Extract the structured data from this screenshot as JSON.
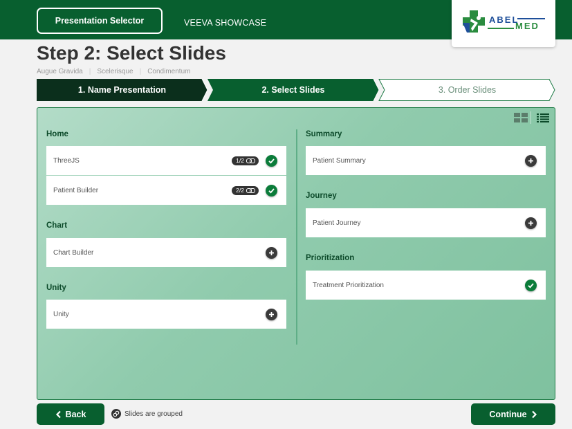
{
  "header": {
    "selector_label": "Presentation Selector",
    "showcase_label": "VEEVA SHOWCASE",
    "logo_top": "ABEL",
    "logo_bottom": "MED"
  },
  "page": {
    "title": "Step 2: Select Slides",
    "breadcrumb": [
      "Augue Gravida",
      "Scelerisque",
      "Condimentum"
    ]
  },
  "steps": [
    {
      "label": "1. Name Presentation",
      "state": "done"
    },
    {
      "label": "2. Select Slides",
      "state": "active"
    },
    {
      "label": "3. Order Slides",
      "state": "pending"
    }
  ],
  "columns": {
    "left": [
      {
        "title": "Home",
        "items": [
          {
            "label": "ThreeJS",
            "badge": "1/2",
            "status": "selected"
          },
          {
            "label": "Patient Builder",
            "badge": "2/2",
            "status": "selected"
          }
        ]
      },
      {
        "title": "Chart",
        "items": [
          {
            "label": "Chart Builder",
            "status": "add"
          }
        ]
      },
      {
        "title": "Unity",
        "items": [
          {
            "label": "Unity",
            "status": "add"
          }
        ]
      }
    ],
    "right": [
      {
        "title": "Summary",
        "items": [
          {
            "label": "Patient Summary",
            "status": "add"
          }
        ]
      },
      {
        "title": "Journey",
        "items": [
          {
            "label": "Patient Journey",
            "status": "add"
          }
        ]
      },
      {
        "title": "Prioritization",
        "items": [
          {
            "label": "Treatment Prioritization",
            "status": "selected"
          }
        ]
      }
    ]
  },
  "icons": {
    "grid_view": "grid-view-icon",
    "list_view": "list-view-icon",
    "selected": "check-circle-icon",
    "add": "plus-circle-icon",
    "group": "link-icon"
  },
  "footer": {
    "back_label": "Back",
    "grouped_note": "Slides are grouped",
    "continue_label": "Continue"
  },
  "colors": {
    "brand": "#085f2f",
    "step_done": "#0b2f1c",
    "check": "#0b7c3a"
  }
}
